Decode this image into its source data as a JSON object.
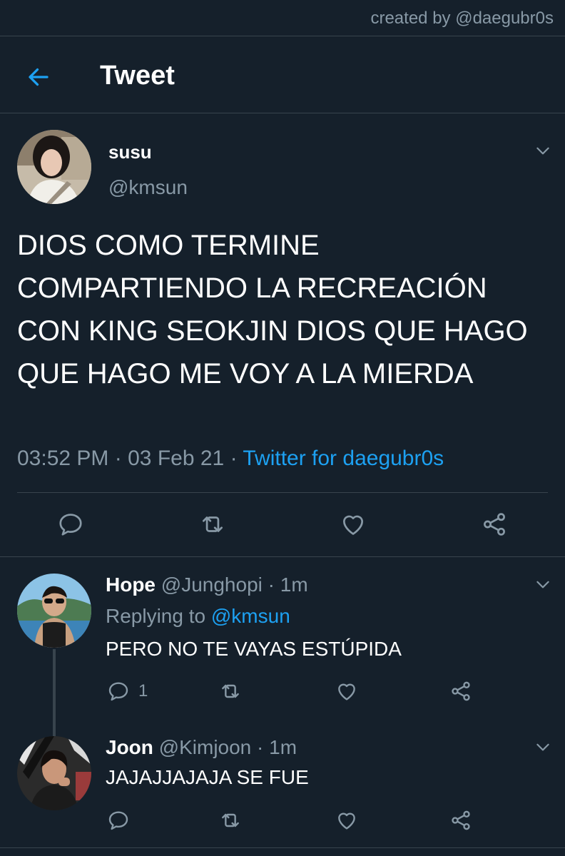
{
  "watermark": "created by @daegubr0s",
  "header": {
    "title": "Tweet",
    "back_icon": "arrow-left-icon"
  },
  "colors": {
    "background": "#15202b",
    "accent": "#1da1f2",
    "muted": "#8899a6",
    "divider": "#38444d"
  },
  "main_tweet": {
    "name": "susu",
    "handle": "@kmsun",
    "text": "DIOS COMO TERMINE COMPARTIENDO LA RECREACIÓN CON KING SEOKJIN DIOS QUE HAGO QUE HAGO ME VOY A LA MIERDA",
    "time": "03:52 PM",
    "date": "03 Feb 21",
    "separator": "·",
    "source": "Twitter for daegubr0s"
  },
  "replies": [
    {
      "name": "Hope",
      "handle": "@Junghopi",
      "separator": "·",
      "time": "1m",
      "replying_label": "Replying to",
      "replying_to": "@kmsun",
      "text": "PERO NO TE VAYAS ESTÚPIDA",
      "reply_count": "1"
    },
    {
      "name": "Joon",
      "handle": "@Kimjoon",
      "separator": "·",
      "time": "1m",
      "text": "JAJAJJAJAJA SE FUE"
    }
  ]
}
